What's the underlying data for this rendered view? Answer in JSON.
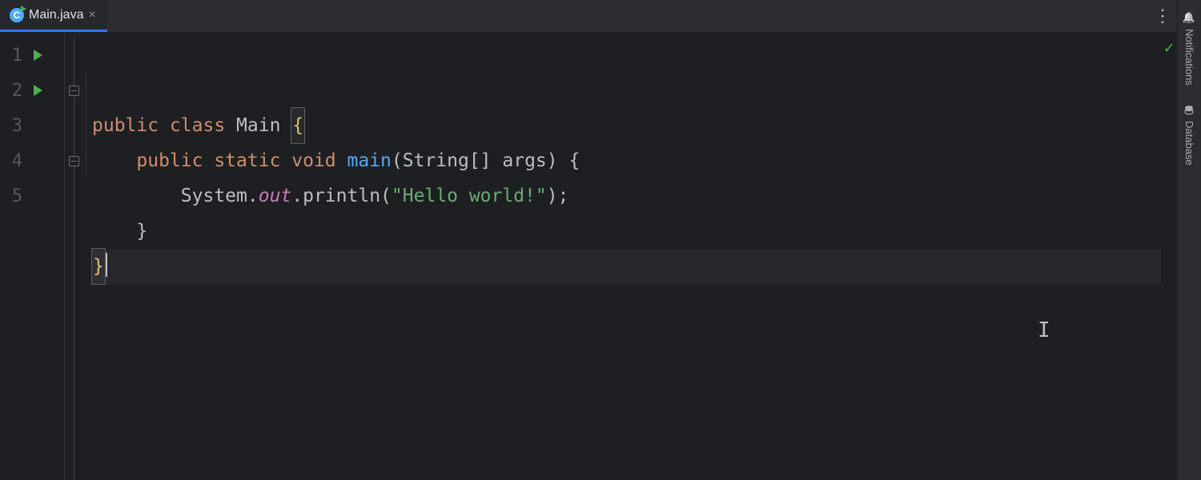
{
  "tab": {
    "filename": "Main.java",
    "close_glyph": "×"
  },
  "gutter": {
    "lines": [
      "1",
      "2",
      "3",
      "4",
      "5"
    ],
    "runnable_lines": [
      0,
      1
    ]
  },
  "code": {
    "lines": [
      [
        {
          "cls": "kw",
          "t": "public "
        },
        {
          "cls": "kw",
          "t": "class "
        },
        {
          "cls": "id",
          "t": "Main "
        },
        {
          "cls": "brace-y hlbr",
          "t": "{"
        }
      ],
      [
        {
          "cls": "",
          "t": "    "
        },
        {
          "cls": "kw",
          "t": "public "
        },
        {
          "cls": "kw",
          "t": "static "
        },
        {
          "cls": "kw",
          "t": "void "
        },
        {
          "cls": "mtd",
          "t": "main"
        },
        {
          "cls": "punc",
          "t": "(String[] args) {"
        }
      ],
      [
        {
          "cls": "",
          "t": "        "
        },
        {
          "cls": "id",
          "t": "System."
        },
        {
          "cls": "fld",
          "t": "out"
        },
        {
          "cls": "id",
          "t": ".println("
        },
        {
          "cls": "str",
          "t": "\"Hello world!\""
        },
        {
          "cls": "punc",
          "t": ");"
        }
      ],
      [
        {
          "cls": "",
          "t": "    "
        },
        {
          "cls": "punc",
          "t": "}"
        }
      ],
      [
        {
          "cls": "brace-y hlbr",
          "t": "}"
        },
        {
          "cls": "caret",
          "t": ""
        }
      ]
    ],
    "current_line": 4
  },
  "sidebar": {
    "buttons": [
      {
        "id": "notifications",
        "label": "Notifications",
        "icon": "bell"
      },
      {
        "id": "database",
        "label": "Database",
        "icon": "db"
      }
    ]
  },
  "inspection_status": "ok"
}
